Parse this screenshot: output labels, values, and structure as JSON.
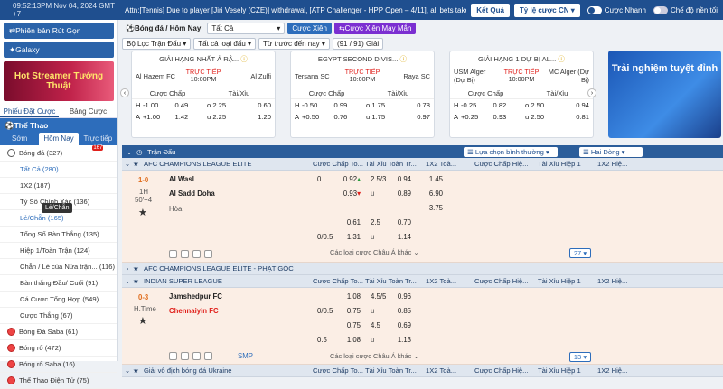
{
  "topbar": {
    "clock": "09:52:13PM Nov 04, 2024 GMT +7",
    "announcement": "Attn:[Tennis] Due to player [Jiri Vesely (CZE)] withdrawal, [ATP Challenger - HPP Open – 4/11], all bets taken",
    "results_btn": "Kết Quả",
    "odds_btn": "Tỷ lệ cược CN",
    "quick_bet": "Cược Nhanh",
    "dark_mode": "Chế độ nền tối"
  },
  "sidebar": {
    "version_btn": "Phiên bản Rút Gọn",
    "galaxy_btn": "Galaxy",
    "banner": "Hot Streamer Tướng Thuật",
    "tabs": [
      "Phiếu Đặt Cược",
      "Bảng Cược"
    ],
    "sport_header": "Thể Thao",
    "subtabs": [
      "Sớm",
      "Hôm Nay",
      "Trực tiếp"
    ],
    "live_count": "167",
    "items": [
      {
        "label": "Bóng đá",
        "count": "(327)",
        "type": "sport"
      },
      {
        "label": "Tất Cả",
        "count": "(280)",
        "type": "link"
      },
      {
        "label": "1X2",
        "count": "(187)",
        "type": "sub"
      },
      {
        "label": "Tỷ Số Chính Xác",
        "count": "(136)",
        "type": "sub"
      },
      {
        "label": "Lẻ/Chẵn",
        "count": "(165)",
        "type": "link"
      },
      {
        "label": "Tổng Số Bàn Thắng",
        "count": "(135)",
        "type": "sub"
      },
      {
        "label": "Hiệp 1/Toàn Trận",
        "count": "(124)",
        "type": "sub"
      },
      {
        "label": "Chẵn / Lẻ của Nửa trận...",
        "count": "(116)",
        "type": "sub"
      },
      {
        "label": "Bàn thắng Đầu/ Cuối",
        "count": "(91)",
        "type": "sub"
      },
      {
        "label": "Cá Cược Tổng Hợp",
        "count": "(549)",
        "type": "sub"
      },
      {
        "label": "Cược Thắng",
        "count": "(67)",
        "type": "sub"
      },
      {
        "label": "Bóng Đá Saba",
        "count": "(61)",
        "type": "sport"
      },
      {
        "label": "Bóng rổ",
        "count": "(472)",
        "type": "sport"
      },
      {
        "label": "Bóng rổ Saba",
        "count": "(16)",
        "type": "sport"
      },
      {
        "label": "Thể Thao Điện Tử",
        "count": "(75)",
        "type": "sport"
      }
    ],
    "tooltip": "Lẻ/Chẵn"
  },
  "filters": {
    "sport": "Bóng đá / Hôm Nay",
    "all": "Tất Cả",
    "parlay": "Cược Xiên",
    "parlay_challenger": "Cược Xiên May Mắn",
    "match_filter": "Bộ Lọc Trận Đấu",
    "bet_types": "Tất cả loại đấu",
    "sort": "Từ trước đến nay",
    "page": "(91 / 91) Giải"
  },
  "cards": [
    {
      "league": "GIẢI HẠNG NHẤT Ả RẬ...",
      "home": "Al Hazem FC",
      "away": "Al Zulfi",
      "live": "TRỰC TIẾP",
      "time": "10:00PM",
      "h_hdp": "-1.00",
      "h_odds": "0.49",
      "ou1": "o 2.25",
      "ou1_odds": "0.60",
      "a_hdp": "+1.00",
      "a_odds": "1.42",
      "ou2": "u 2.25",
      "ou2_odds": "1.20"
    },
    {
      "league": "EGYPT SECOND DIVIS...",
      "home": "Tersana SC",
      "away": "Raya SC",
      "live": "TRỰC TIẾP",
      "time": "10:00PM",
      "h_hdp": "-0.50",
      "h_odds": "0.99",
      "ou1": "o 1.75",
      "ou1_odds": "0.78",
      "a_hdp": "+0.50",
      "a_odds": "0.76",
      "ou2": "u 1.75",
      "ou2_odds": "0.97"
    },
    {
      "league": "GIẢI HẠNG 1 DỰ BỊ AL...",
      "home": "USM Alger (Dự Bị)",
      "away": "MC Alger (Dự Bị)",
      "live": "TRỰC TIẾP",
      "time": "10:00PM",
      "h_hdp": "-0.25",
      "h_odds": "0.82",
      "ou1": "o 2.50",
      "ou1_odds": "0.94",
      "a_hdp": "+0.25",
      "a_odds": "0.93",
      "ou2": "u 2.50",
      "ou2_odds": "0.81"
    }
  ],
  "card_cols": [
    "Cược Chấp",
    "Tài/Xỉu"
  ],
  "card_h": "H",
  "card_a": "A",
  "promo": "Trải nghiệm tuyệt đỉnh",
  "table": {
    "header_label": "Trận Đấu",
    "view_select": "Lựa chọn bình thường",
    "lines_select": "Hai Dòng",
    "col1": "Cược Chấp To...",
    "col2": "Tài Xỉu Toàn Tr...",
    "col3": "1X2 Toà...",
    "col4": "Cược Chấp Hiệ...",
    "col5": "Tài Xỉu Hiệp 1",
    "col6": "1X2 Hiệ...",
    "leagues": [
      {
        "name": "AFC CHAMPIONS LEAGUE ELITE"
      },
      {
        "name": "AFC CHAMPIONS LEAGUE ELITE - PHẠT GÓC"
      },
      {
        "name": "INDIAN SUPER LEAGUE"
      },
      {
        "name": "Giải vô địch bóng đá Ukraine"
      }
    ],
    "match1": {
      "score": "1-0",
      "period": "1H",
      "minute": "50'+4",
      "home": "Al Wasl",
      "away": "Al Sadd Doha",
      "draw": "Hòa",
      "r1_hdp": "0",
      "r1_odds": "0.92",
      "r1_ou": "2.5/3",
      "r1_ou_odds": "0.94",
      "r1_x": "1.45",
      "r2_odds": "0.93",
      "r2_u": "u",
      "r2_u_odds": "0.89",
      "r2_x": "6.90",
      "r3_x": "3.75",
      "r4_odds": "0.61",
      "r4_ou": "2.5",
      "r4_ou_odds": "0.70",
      "r5_hdp": "0/0.5",
      "r5_odds": "1.31",
      "r5_u": "u",
      "r5_u_odds": "1.14",
      "more": "Các loại cược Châu Á khác",
      "count": "27"
    },
    "match2": {
      "score": "0-3",
      "period": "H.Time",
      "home": "Jamshedpur FC",
      "away": "Chennaiyin FC",
      "r1_odds": "1.08",
      "r1_ou": "4.5/5",
      "r1_ou_odds": "0.96",
      "r2_hdp": "0/0.5",
      "r2_odds": "0.75",
      "r2_u": "u",
      "r2_u_odds": "0.85",
      "r3_odds": "0.75",
      "r3_ou": "4.5",
      "r3_ou_odds": "0.69",
      "r4_hdp": "0.5",
      "r4_odds": "1.08",
      "r4_u": "u",
      "r4_u_odds": "1.13",
      "more": "Các loại cược Châu Á khác",
      "count": "13",
      "smp": "SMP"
    }
  }
}
